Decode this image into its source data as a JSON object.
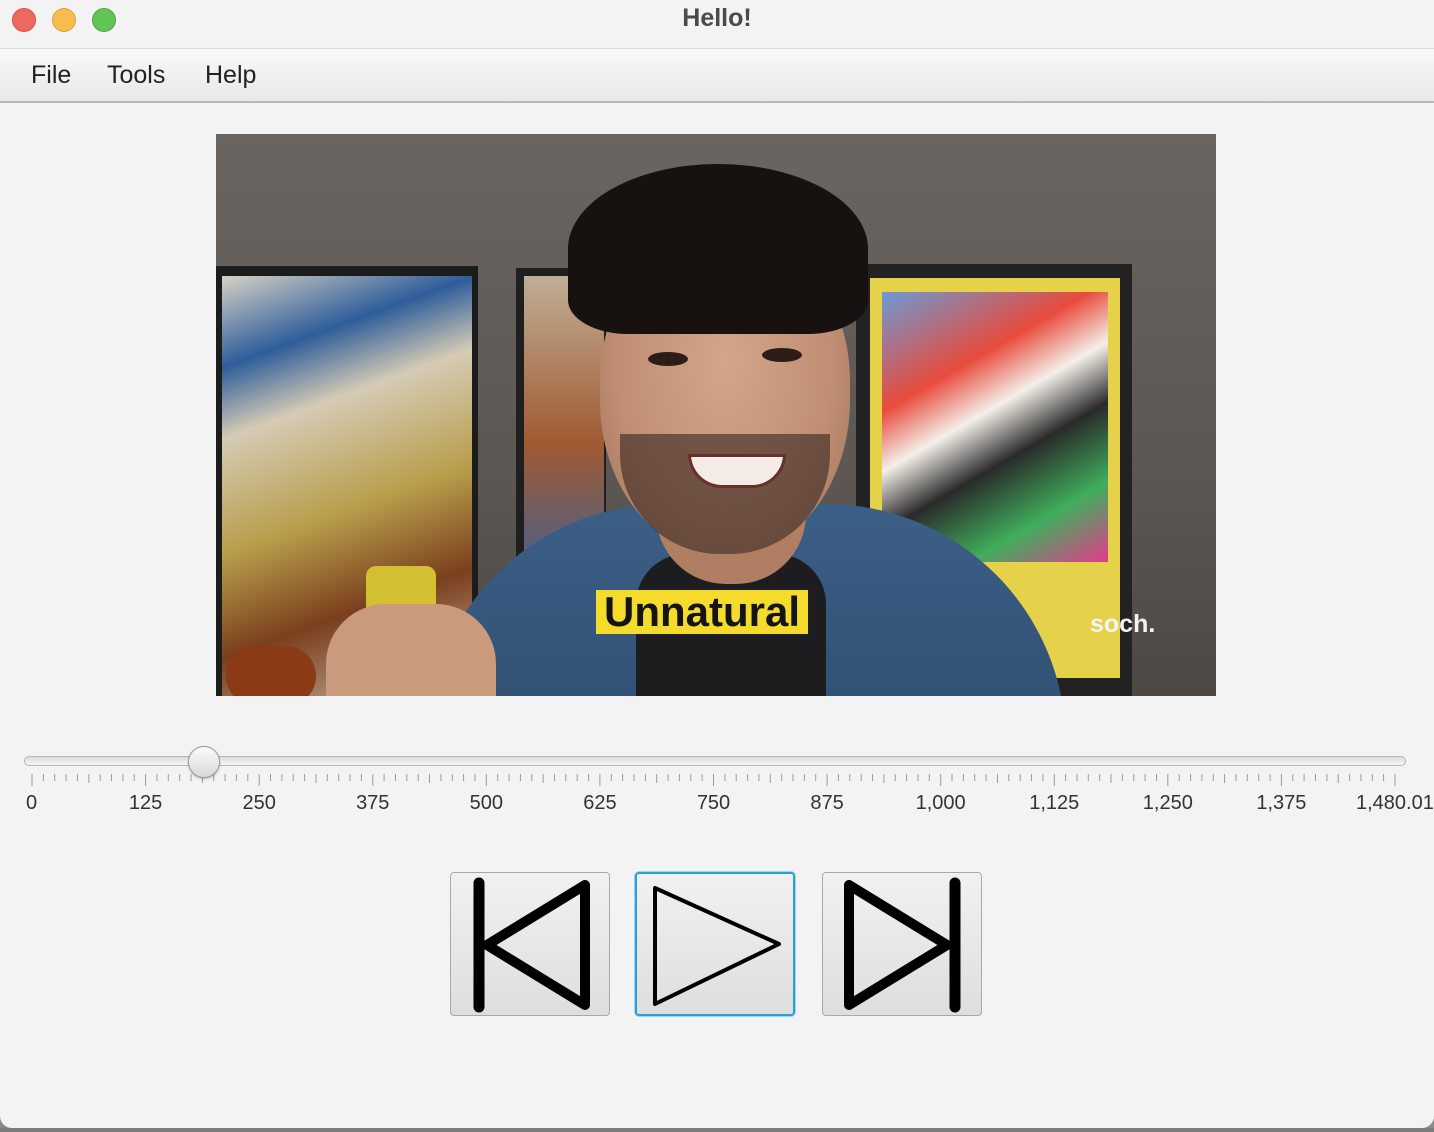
{
  "window": {
    "title": "Hello!"
  },
  "menu": {
    "items": [
      "File",
      "Tools",
      "Help"
    ]
  },
  "video": {
    "caption": "Unnatural",
    "watermark": "soch."
  },
  "slider": {
    "value": 187,
    "min": 0,
    "max": 1480.01,
    "tick_labels": [
      "0",
      "125",
      "250",
      "375",
      "500",
      "625",
      "750",
      "875",
      "1,000",
      "1,125",
      "1,250",
      "1,375",
      "1,480.01"
    ]
  },
  "controls": {
    "previous_icon": "skip-previous-icon",
    "play_icon": "play-icon",
    "next_icon": "skip-next-icon"
  }
}
